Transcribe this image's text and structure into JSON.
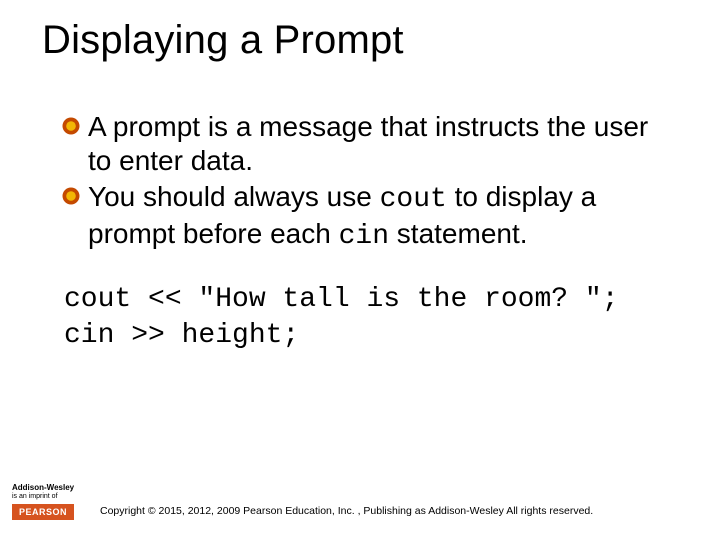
{
  "title": "Displaying a Prompt",
  "bullets": [
    {
      "pre": "A prompt is a message that instructs the user to enter data.",
      "code": "",
      "post": ""
    },
    {
      "pre": "You should always use ",
      "code": "cout",
      "mid": " to display a prompt before each ",
      "code2": "cin",
      "post": " statement."
    }
  ],
  "code_lines": [
    "cout << \"How tall is the room? \";",
    "cin >> height;"
  ],
  "footer": {
    "brand_top": "Addison-Wesley",
    "brand_sub": "is an imprint of",
    "pearson": "PEARSON",
    "copyright": "Copyright © 2015, 2012, 2009 Pearson Education, Inc. , Publishing as Addison-Wesley All rights reserved."
  },
  "colors": {
    "bullet_outer": "#c44a00",
    "bullet_inner": "#f2b705",
    "pearson_bg": "#d6531f"
  }
}
